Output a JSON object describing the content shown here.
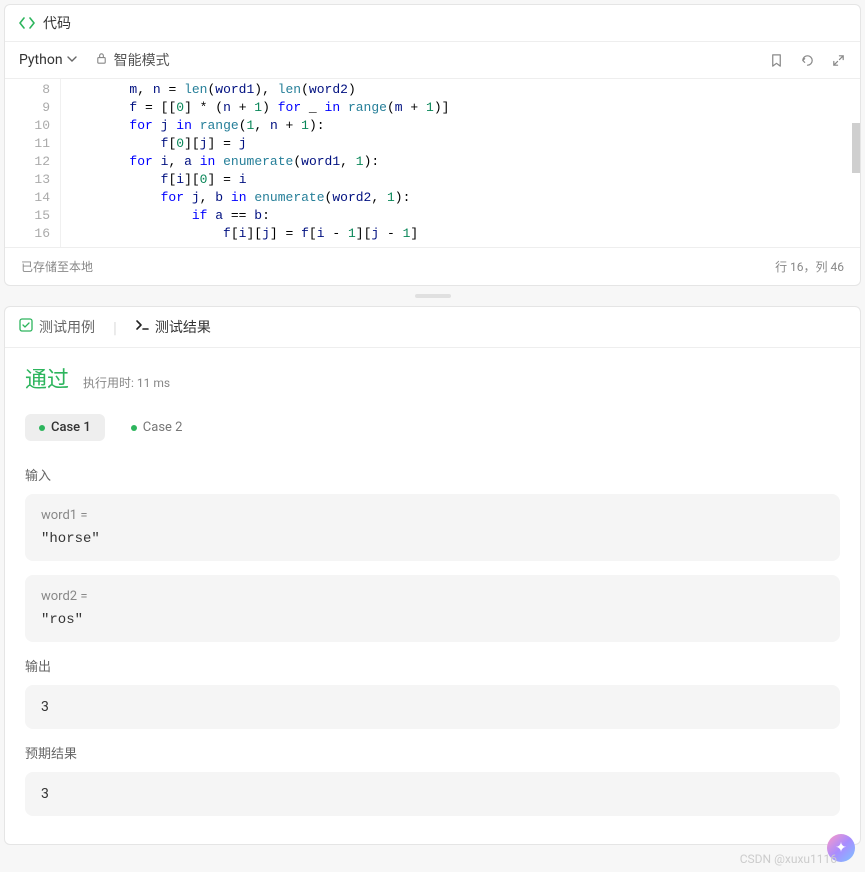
{
  "header": {
    "title": "代码"
  },
  "toolbar": {
    "language": "Python",
    "smart_mode": "智能模式"
  },
  "editor": {
    "first_line_no": 8,
    "lines": [
      {
        "no": 8,
        "indent": 2,
        "tokens": [
          [
            "id",
            "m"
          ],
          [
            "op",
            ", "
          ],
          [
            "id",
            "n"
          ],
          [
            "op",
            " = "
          ],
          [
            "fn",
            "len"
          ],
          [
            "pn",
            "("
          ],
          [
            "id",
            "word1"
          ],
          [
            "pn",
            "), "
          ],
          [
            "fn",
            "len"
          ],
          [
            "pn",
            "("
          ],
          [
            "id",
            "word2"
          ],
          [
            "pn",
            ")"
          ]
        ]
      },
      {
        "no": 9,
        "indent": 2,
        "tokens": [
          [
            "id",
            "f"
          ],
          [
            "op",
            " = "
          ],
          [
            "pn",
            "[["
          ],
          [
            "num",
            "0"
          ],
          [
            "pn",
            "] * ("
          ],
          [
            "id",
            "n"
          ],
          [
            "op",
            " + "
          ],
          [
            "num",
            "1"
          ],
          [
            "pn",
            ") "
          ],
          [
            "kw",
            "for"
          ],
          [
            "op",
            " _ "
          ],
          [
            "kw",
            "in"
          ],
          [
            "op",
            " "
          ],
          [
            "fn",
            "range"
          ],
          [
            "pn",
            "("
          ],
          [
            "id",
            "m"
          ],
          [
            "op",
            " + "
          ],
          [
            "num",
            "1"
          ],
          [
            "pn",
            ")]"
          ]
        ]
      },
      {
        "no": 10,
        "indent": 2,
        "tokens": [
          [
            "kw",
            "for"
          ],
          [
            "op",
            " "
          ],
          [
            "id",
            "j"
          ],
          [
            "op",
            " "
          ],
          [
            "kw",
            "in"
          ],
          [
            "op",
            " "
          ],
          [
            "fn",
            "range"
          ],
          [
            "pn",
            "("
          ],
          [
            "num",
            "1"
          ],
          [
            "op",
            ", "
          ],
          [
            "id",
            "n"
          ],
          [
            "op",
            " + "
          ],
          [
            "num",
            "1"
          ],
          [
            "pn",
            "):"
          ]
        ]
      },
      {
        "no": 11,
        "indent": 3,
        "tokens": [
          [
            "id",
            "f"
          ],
          [
            "pn",
            "["
          ],
          [
            "num",
            "0"
          ],
          [
            "pn",
            "]["
          ],
          [
            "id",
            "j"
          ],
          [
            "pn",
            "] = "
          ],
          [
            "id",
            "j"
          ]
        ]
      },
      {
        "no": 12,
        "indent": 2,
        "tokens": [
          [
            "kw",
            "for"
          ],
          [
            "op",
            " "
          ],
          [
            "id",
            "i"
          ],
          [
            "op",
            ", "
          ],
          [
            "id",
            "a"
          ],
          [
            "op",
            " "
          ],
          [
            "kw",
            "in"
          ],
          [
            "op",
            " "
          ],
          [
            "fn",
            "enumerate"
          ],
          [
            "pn",
            "("
          ],
          [
            "id",
            "word1"
          ],
          [
            "op",
            ", "
          ],
          [
            "num",
            "1"
          ],
          [
            "pn",
            "):"
          ]
        ]
      },
      {
        "no": 13,
        "indent": 3,
        "tokens": [
          [
            "id",
            "f"
          ],
          [
            "pn",
            "["
          ],
          [
            "id",
            "i"
          ],
          [
            "pn",
            "]["
          ],
          [
            "num",
            "0"
          ],
          [
            "pn",
            "] = "
          ],
          [
            "id",
            "i"
          ]
        ]
      },
      {
        "no": 14,
        "indent": 3,
        "tokens": [
          [
            "kw",
            "for"
          ],
          [
            "op",
            " "
          ],
          [
            "id",
            "j"
          ],
          [
            "op",
            ", "
          ],
          [
            "id",
            "b"
          ],
          [
            "op",
            " "
          ],
          [
            "kw",
            "in"
          ],
          [
            "op",
            " "
          ],
          [
            "fn",
            "enumerate"
          ],
          [
            "pn",
            "("
          ],
          [
            "id",
            "word2"
          ],
          [
            "op",
            ", "
          ],
          [
            "num",
            "1"
          ],
          [
            "pn",
            "):"
          ]
        ]
      },
      {
        "no": 15,
        "indent": 4,
        "tokens": [
          [
            "kw",
            "if"
          ],
          [
            "op",
            " "
          ],
          [
            "id",
            "a"
          ],
          [
            "op",
            " == "
          ],
          [
            "id",
            "b"
          ],
          [
            "pn",
            ":"
          ]
        ]
      },
      {
        "no": 16,
        "indent": 5,
        "tokens": [
          [
            "id",
            "f"
          ],
          [
            "pn",
            "["
          ],
          [
            "id",
            "i"
          ],
          [
            "pn",
            "]["
          ],
          [
            "id",
            "j"
          ],
          [
            "pn",
            "] = "
          ],
          [
            "id",
            "f"
          ],
          [
            "pn",
            "["
          ],
          [
            "id",
            "i"
          ],
          [
            "op",
            " - "
          ],
          [
            "num",
            "1"
          ],
          [
            "pn",
            "]["
          ],
          [
            "id",
            "j"
          ],
          [
            "op",
            " - "
          ],
          [
            "num",
            "1"
          ],
          [
            "pn",
            "]"
          ]
        ]
      }
    ]
  },
  "status": {
    "saved": "已存储至本地",
    "cursor": "行 16，列 46"
  },
  "tabs": {
    "testcase": "测试用例",
    "result": "测试结果"
  },
  "result": {
    "pass_label": "通过",
    "runtime_label": "执行用时: 11 ms",
    "cases": [
      {
        "label": "Case 1",
        "active": true
      },
      {
        "label": "Case 2",
        "active": false
      }
    ],
    "input_label": "输入",
    "inputs": [
      {
        "name": "word1 =",
        "value": "\"horse\""
      },
      {
        "name": "word2 =",
        "value": "\"ros\""
      }
    ],
    "output_label": "输出",
    "output_value": "3",
    "expected_label": "预期结果",
    "expected_value": "3"
  },
  "watermark": "CSDN @xuxu1116"
}
